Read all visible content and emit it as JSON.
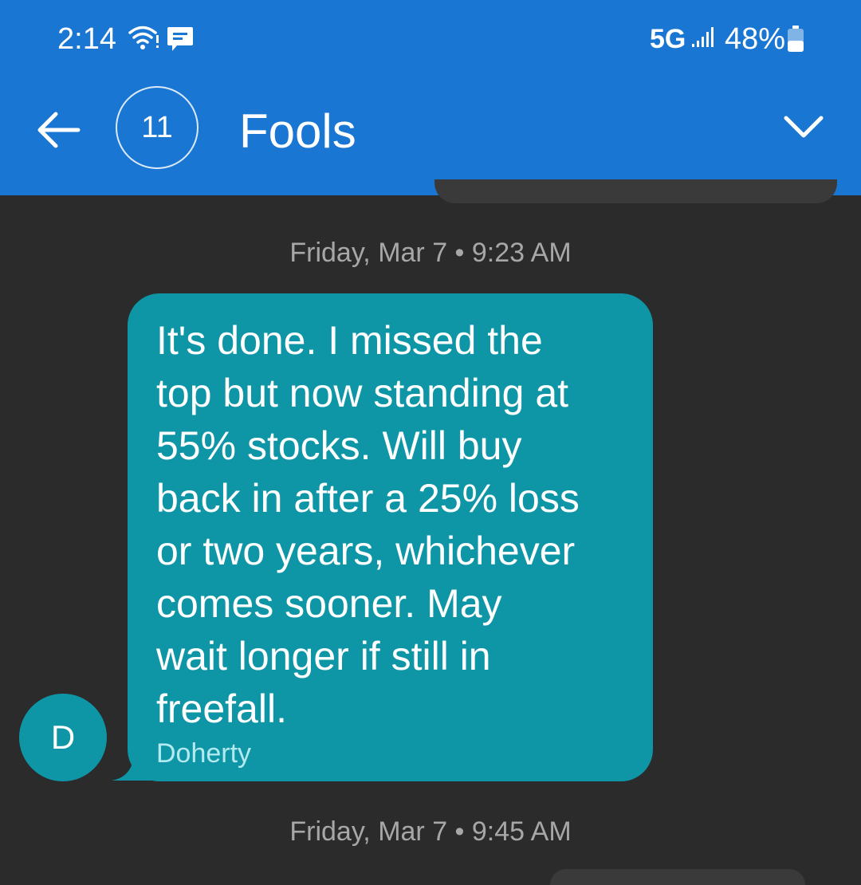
{
  "status_bar": {
    "time": "2:14",
    "network": "5G",
    "battery": "48%",
    "battery_level": 0.48
  },
  "header": {
    "participant_count": "11",
    "title": "Fools"
  },
  "thread": {
    "messages": [
      {
        "date": "Friday, Mar 7 • 9:23 AM",
        "avatar_initial": "D",
        "text": "It's done. I missed the\ntop but now standing at\n55% stocks.  Will buy\nback in after a 25% loss\nor two years, whichever\ncomes sooner.  May\nwait longer if still in\nfreefall.",
        "sender": "Doherty"
      }
    ],
    "next_date": "Friday, Mar 7 • 9:45 AM"
  },
  "colors": {
    "app_bar": "#1976d2",
    "background": "#2b2b2b",
    "bubble": "#0f96a6",
    "date_text": "#a7a7a7"
  }
}
